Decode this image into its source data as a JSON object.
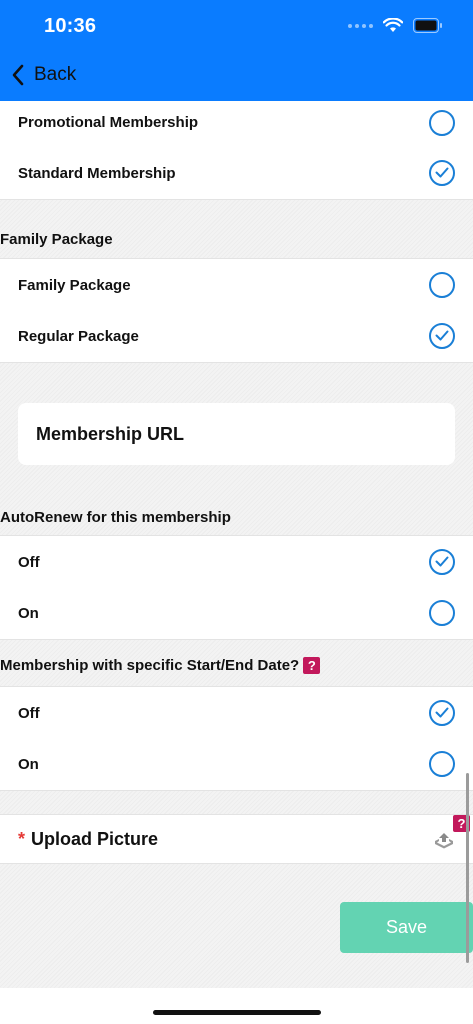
{
  "status_bar": {
    "time": "10:36"
  },
  "nav": {
    "back_label": "Back"
  },
  "membership_type": {
    "items": [
      {
        "label": "Promotional Membership",
        "selected": false
      },
      {
        "label": "Standard Membership",
        "selected": true
      }
    ]
  },
  "family_package": {
    "title": "Family Package",
    "items": [
      {
        "label": "Family Package",
        "selected": false
      },
      {
        "label": "Regular Package",
        "selected": true
      }
    ]
  },
  "membership_url": {
    "label": "Membership URL"
  },
  "autorenew": {
    "title": "AutoRenew for this membership",
    "items": [
      {
        "label": "Off",
        "selected": true
      },
      {
        "label": "On",
        "selected": false
      }
    ]
  },
  "specific_dates": {
    "title": "Membership with specific Start/End Date?",
    "help_glyph": "?",
    "items": [
      {
        "label": "Off",
        "selected": true
      },
      {
        "label": "On",
        "selected": false
      }
    ]
  },
  "upload": {
    "required_mark": "*",
    "label": "Upload Picture",
    "help_glyph": "?"
  },
  "save": {
    "label": "Save"
  },
  "colors": {
    "header": "#0a7cff",
    "radio": "#1a7fd6",
    "save": "#63d3b2",
    "help": "#c2185b"
  }
}
